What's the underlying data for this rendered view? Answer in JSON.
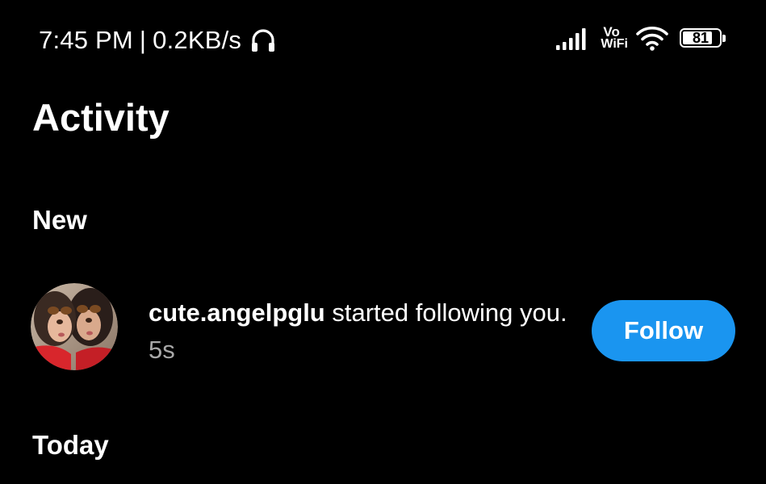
{
  "status_bar": {
    "time": "7:45 PM",
    "separator": "|",
    "network_speed": "0.2KB/s",
    "vo_label": "Vo",
    "wifi_label": "WiFi",
    "battery_level": "81",
    "battery_fraction": 0.81,
    "icons": [
      "headphones-icon",
      "signal-icon",
      "wifi-icon",
      "battery-icon"
    ]
  },
  "header": {
    "title": "Activity"
  },
  "sections": {
    "new_label": "New",
    "today_label": "Today"
  },
  "notification": {
    "username": "cute.angelpglu",
    "action": " started following you.",
    "time": "5s",
    "button_label": "Follow"
  },
  "colors": {
    "background": "#000000",
    "text": "#ffffff",
    "secondary_text": "#a8a8a8",
    "accent": "#1a95f0"
  }
}
